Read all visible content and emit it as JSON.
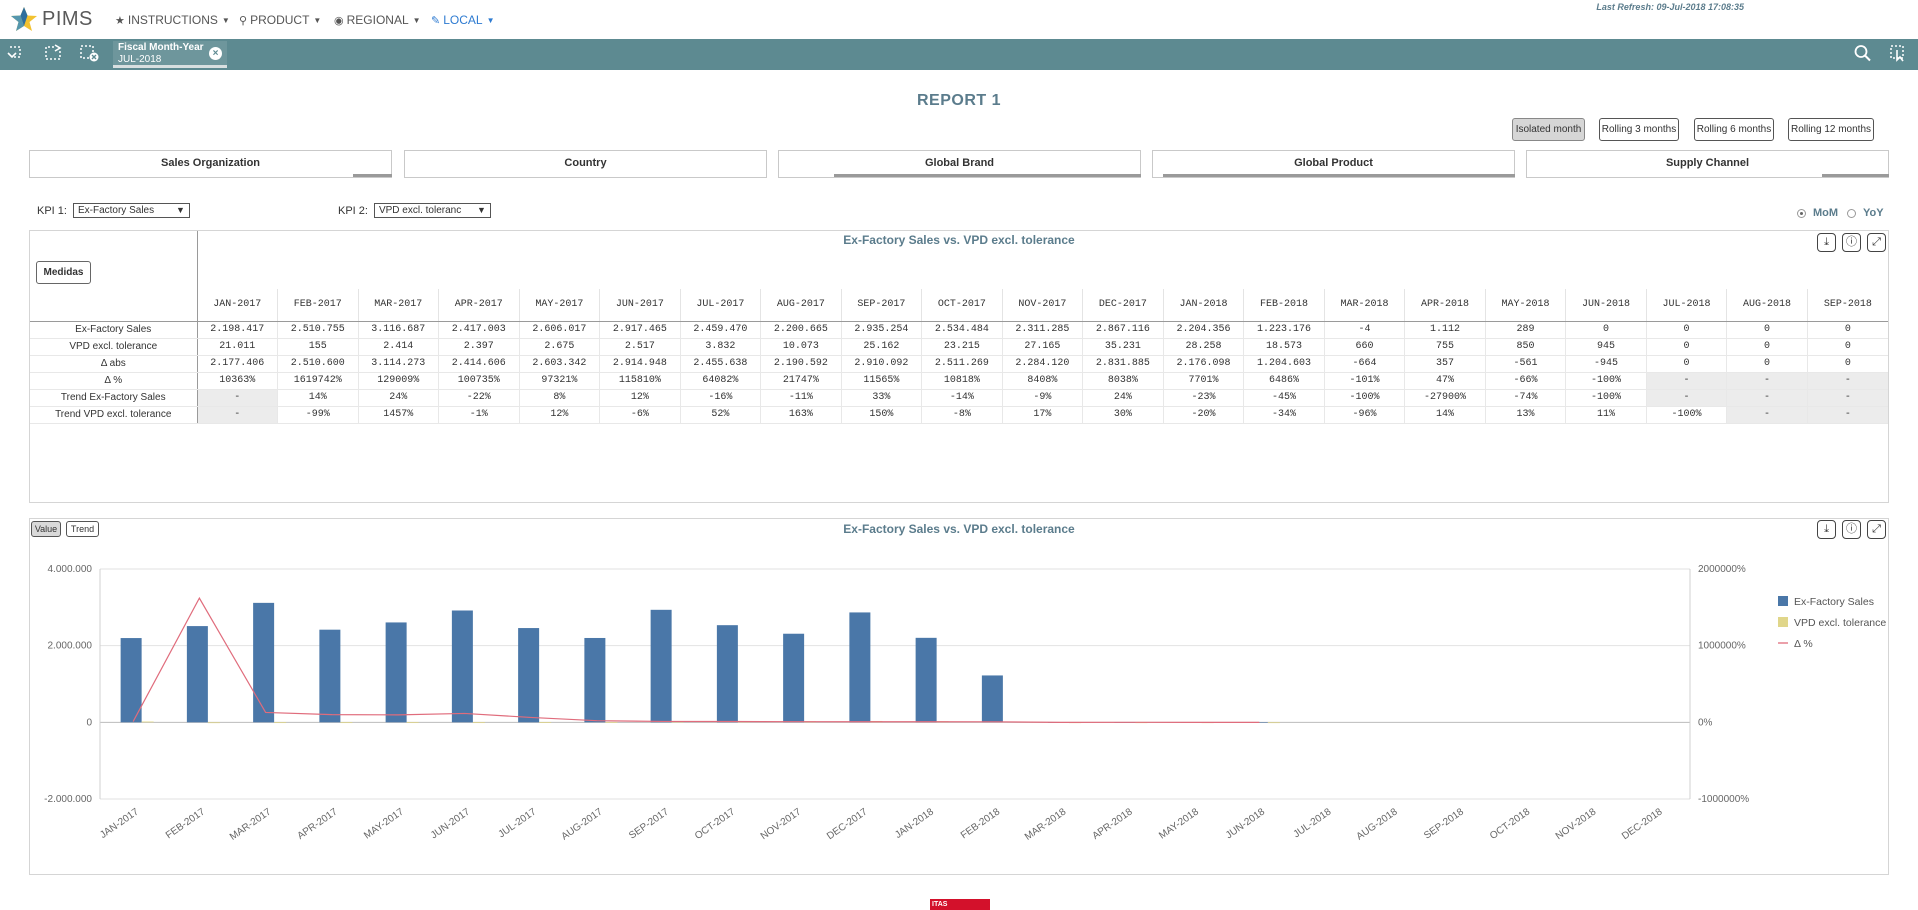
{
  "app": {
    "name": "PIMS",
    "last_refresh": "Last Refresh: 09-Jul-2018 17:08:35"
  },
  "nav": [
    {
      "label": "INSTRUCTIONS",
      "icon": "star-icon"
    },
    {
      "label": "PRODUCT",
      "icon": "search-icon"
    },
    {
      "label": "REGIONAL",
      "icon": "globe-icon"
    },
    {
      "label": "LOCAL",
      "icon": "pin-icon",
      "active": true
    }
  ],
  "selection": {
    "field": "Fiscal Month-Year",
    "value": "JUL-2018"
  },
  "report": {
    "title": "REPORT 1"
  },
  "periods": [
    "Isolated month",
    "Rolling 3 months",
    "Rolling 6 months",
    "Rolling 12 months"
  ],
  "filters": [
    "Sales Organization",
    "Country",
    "Global Brand",
    "Global Product",
    "Supply Channel"
  ],
  "kpi1": {
    "label": "KPI 1:",
    "value": "Ex-Factory Sales"
  },
  "kpi2": {
    "label": "KPI 2:",
    "value": "VPD excl. toleranc"
  },
  "compare": {
    "mom": "MoM",
    "yoy": "YoY"
  },
  "table_panel": {
    "title": "Ex-Factory Sales vs. VPD excl. tolerance",
    "medidas_label": "Medidas",
    "months": [
      "JAN-2017",
      "FEB-2017",
      "MAR-2017",
      "APR-2017",
      "MAY-2017",
      "JUN-2017",
      "JUL-2017",
      "AUG-2017",
      "SEP-2017",
      "OCT-2017",
      "NOV-2017",
      "DEC-2017",
      "JAN-2018",
      "FEB-2018",
      "MAR-2018",
      "APR-2018",
      "MAY-2018",
      "JUN-2018",
      "JUL-2018",
      "AUG-2018",
      "SEP-2018"
    ],
    "rows": [
      {
        "label": "Ex-Factory Sales",
        "values": [
          "2.198.417",
          "2.510.755",
          "3.116.687",
          "2.417.003",
          "2.606.017",
          "2.917.465",
          "2.459.470",
          "2.200.665",
          "2.935.254",
          "2.534.484",
          "2.311.285",
          "2.867.116",
          "2.204.356",
          "1.223.176",
          "-4",
          "1.112",
          "289",
          "0",
          "0",
          "0",
          "0"
        ]
      },
      {
        "label": "VPD excl. tolerance",
        "values": [
          "21.011",
          "155",
          "2.414",
          "2.397",
          "2.675",
          "2.517",
          "3.832",
          "10.073",
          "25.162",
          "23.215",
          "27.165",
          "35.231",
          "28.258",
          "18.573",
          "660",
          "755",
          "850",
          "945",
          "0",
          "0",
          "0"
        ]
      },
      {
        "label": "Δ abs",
        "values": [
          "2.177.406",
          "2.510.600",
          "3.114.273",
          "2.414.606",
          "2.603.342",
          "2.914.948",
          "2.455.638",
          "2.190.592",
          "2.910.092",
          "2.511.269",
          "2.284.120",
          "2.831.885",
          "2.176.098",
          "1.204.603",
          "-664",
          "357",
          "-561",
          "-945",
          "0",
          "0",
          "0"
        ]
      },
      {
        "label": "Δ %",
        "values": [
          "10363%",
          "1619742%",
          "129009%",
          "100735%",
          "97321%",
          "115810%",
          "64082%",
          "21747%",
          "11565%",
          "10818%",
          "8408%",
          "8038%",
          "7701%",
          "6486%",
          "-101%",
          "47%",
          "-66%",
          "-100%",
          "-",
          "-",
          "-"
        ]
      },
      {
        "label": "Trend Ex-Factory Sales",
        "values": [
          "-",
          "14%",
          "24%",
          "-22%",
          "8%",
          "12%",
          "-16%",
          "-11%",
          "33%",
          "-14%",
          "-9%",
          "24%",
          "-23%",
          "-45%",
          "-100%",
          "-27900%",
          "-74%",
          "-100%",
          "-",
          "-",
          "-"
        ]
      },
      {
        "label": "Trend VPD excl. tolerance",
        "values": [
          "-",
          "-99%",
          "1457%",
          "-1%",
          "12%",
          "-6%",
          "52%",
          "163%",
          "150%",
          "-8%",
          "17%",
          "30%",
          "-20%",
          "-34%",
          "-96%",
          "14%",
          "13%",
          "11%",
          "-100%",
          "-",
          "-"
        ]
      }
    ]
  },
  "chart_panel": {
    "title": "Ex-Factory Sales vs. VPD excl. tolerance",
    "toggle": [
      "Value",
      "Trend"
    ]
  },
  "chart_data": {
    "type": "bar",
    "title": "Ex-Factory Sales vs. VPD excl. tolerance",
    "categories": [
      "JAN-2017",
      "FEB-2017",
      "MAR-2017",
      "APR-2017",
      "MAY-2017",
      "JUN-2017",
      "JUL-2017",
      "AUG-2017",
      "SEP-2017",
      "OCT-2017",
      "NOV-2017",
      "DEC-2017",
      "JAN-2018",
      "FEB-2018",
      "MAR-2018",
      "APR-2018",
      "MAY-2018",
      "JUN-2018",
      "JUL-2018",
      "AUG-2018",
      "SEP-2018",
      "OCT-2018",
      "NOV-2018",
      "DEC-2018"
    ],
    "ylim": [
      -2000000,
      4000000
    ],
    "yticks": [
      4000000,
      2000000,
      0,
      -2000000
    ],
    "ytick_labels": [
      "4.000.000",
      "2.000.000",
      "0",
      "-2.000.000"
    ],
    "y2lim": [
      -1000000,
      2000000
    ],
    "y2ticks": [
      2000000,
      1000000,
      0,
      -1000000
    ],
    "y2tick_labels": [
      "2000000%",
      "1000000%",
      "0%",
      "-1000000%"
    ],
    "grid": true,
    "legend_position": "right",
    "series": [
      {
        "name": "Ex-Factory Sales",
        "type": "bar",
        "color": "#4a77a8",
        "values": [
          2198417,
          2510755,
          3116687,
          2417003,
          2606017,
          2917465,
          2459470,
          2200665,
          2935254,
          2534484,
          2311285,
          2867116,
          2204356,
          1223176,
          -4,
          1112,
          289,
          0,
          null,
          null,
          null,
          null,
          null,
          null
        ]
      },
      {
        "name": "VPD excl. tolerance",
        "type": "bar",
        "color": "#e0d68a",
        "values": [
          21011,
          155,
          2414,
          2397,
          2675,
          2517,
          3832,
          10073,
          25162,
          23215,
          27165,
          35231,
          28258,
          18573,
          660,
          755,
          850,
          945,
          null,
          null,
          null,
          null,
          null,
          null
        ]
      },
      {
        "name": "Δ %",
        "type": "line",
        "axis": "right",
        "color": "#e06c7c",
        "values": [
          10363,
          1619742,
          129009,
          100735,
          97321,
          115810,
          64082,
          21747,
          11565,
          10818,
          8408,
          8038,
          7701,
          6486,
          -101,
          47,
          -66,
          -100,
          null,
          null,
          null,
          null,
          null,
          null
        ]
      }
    ]
  }
}
